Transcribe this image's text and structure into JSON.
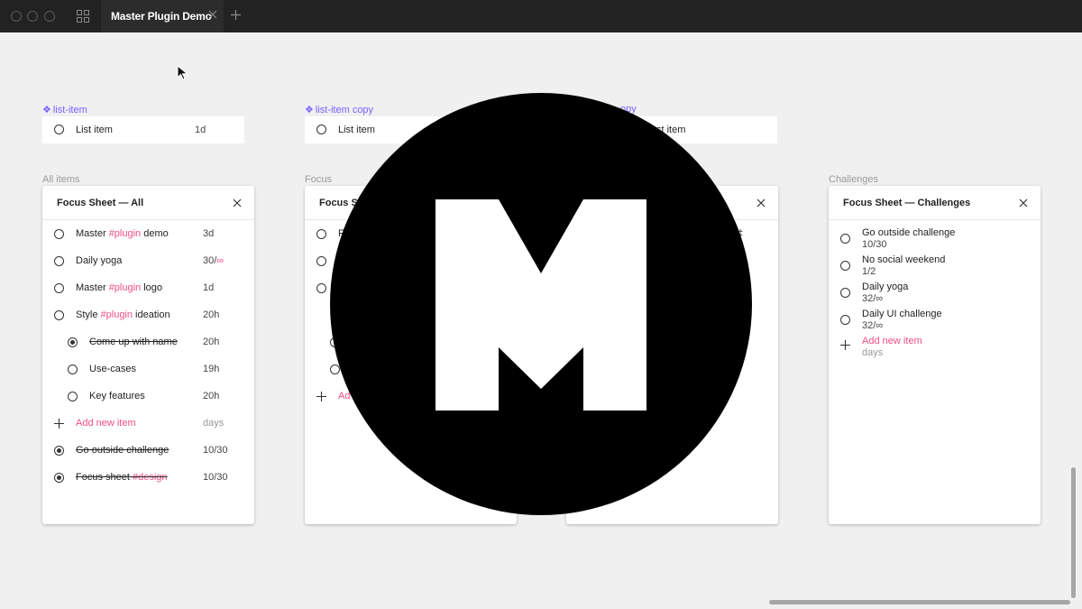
{
  "window": {
    "tab_title": "Master Plugin Demo"
  },
  "components": [
    {
      "label": "list-item",
      "row_label": "List item",
      "row_meta": "1d"
    },
    {
      "label": "list-item copy",
      "row_label": "List item"
    },
    {
      "label": "opy",
      "row_label": "st item"
    }
  ],
  "frames": {
    "all": {
      "frame_label": "All items",
      "title": "Focus Sheet — All",
      "items": [
        {
          "pre": "Master ",
          "tag": "#plugin",
          "post": " demo",
          "meta": "3d",
          "checked": false,
          "done": false,
          "indent": false
        },
        {
          "pre": "Daily yoga",
          "meta_a": "30/",
          "meta_b": "∞",
          "checked": false,
          "done": false,
          "indent": false
        },
        {
          "pre": "Master ",
          "tag": "#plugin",
          "post": " logo",
          "meta": "1d",
          "checked": false,
          "done": false,
          "indent": false
        },
        {
          "pre": "Style ",
          "tag": "#plugin",
          "post": " ideation",
          "meta": "20h",
          "checked": false,
          "done": false,
          "indent": false
        },
        {
          "pre": "Come up with name",
          "meta": "20h",
          "checked": true,
          "done": true,
          "indent": true
        },
        {
          "pre": "Use-cases",
          "meta": "19h",
          "checked": false,
          "done": false,
          "indent": true
        },
        {
          "pre": "Key features",
          "meta": "20h",
          "checked": false,
          "done": false,
          "indent": true
        },
        {
          "pre": "Go outside challenge",
          "meta": "10/30",
          "checked": true,
          "done": true,
          "indent": false
        },
        {
          "pre": "Focus sheet ",
          "tag": "#design",
          "meta": "10/30",
          "checked": true,
          "done": true,
          "indent": false
        }
      ],
      "add_label": "Add new item",
      "add_meta": "days"
    },
    "focus": {
      "frame_label": "Focus",
      "title": "Focus Sh",
      "add_label": "Ad",
      "row_fragment": "F"
    },
    "third": {
      "fragment": "‡"
    },
    "challenges": {
      "frame_label": "Challenges",
      "title": "Focus Sheet — Challenges",
      "items": [
        {
          "name": "Go outside challenge",
          "progress": "10/30"
        },
        {
          "name": "No social weekend",
          "progress": "1/2"
        },
        {
          "name": "Daily yoga",
          "progress": "32/∞"
        },
        {
          "name": "Daily UI challenge",
          "progress": "32/∞"
        }
      ],
      "add_label": "Add new item",
      "add_meta": "days"
    }
  },
  "colors": {
    "accent_purple": "#7b61ff",
    "tag_pink": "#f24e83",
    "overlay": "#000000"
  },
  "overlay_logo": {
    "icon": "m-logo-icon"
  }
}
